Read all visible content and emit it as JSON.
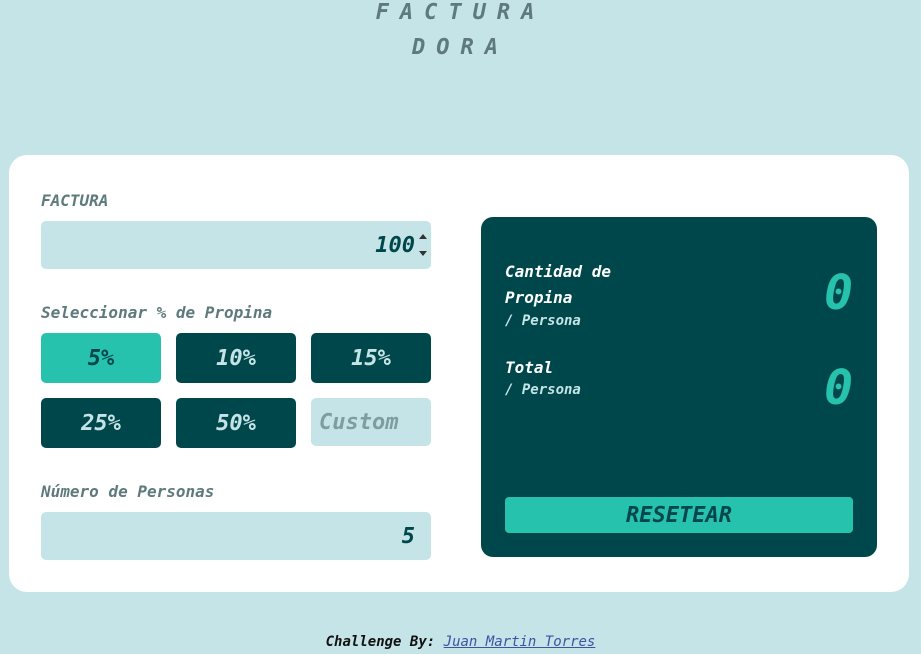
{
  "logo": {
    "line1": "FACTURA",
    "line2": "DORA"
  },
  "bill": {
    "label": "FACTURA",
    "value": "100"
  },
  "tip": {
    "label": "Seleccionar % de Propina",
    "options": [
      "5%",
      "10%",
      "15%",
      "25%",
      "50%"
    ],
    "selected": "5%",
    "custom_placeholder": "Custom"
  },
  "people": {
    "label": "Número de Personas",
    "value": "5"
  },
  "results": {
    "tip_amount": {
      "title_line1": "Cantidad de",
      "title_line2": "Propina",
      "sub": "/ Persona",
      "value": "0"
    },
    "total": {
      "title": "Total",
      "sub": "/ Persona",
      "value": "0"
    },
    "reset_label": "RESETEAR"
  },
  "footer": {
    "prefix": "Challenge By:",
    "author": "Juan Martin Torres"
  },
  "colors": {
    "background": "#c5e4e7",
    "dark_teal": "#00474b",
    "accent": "#26c2ae",
    "muted_text": "#5e7a7d"
  }
}
